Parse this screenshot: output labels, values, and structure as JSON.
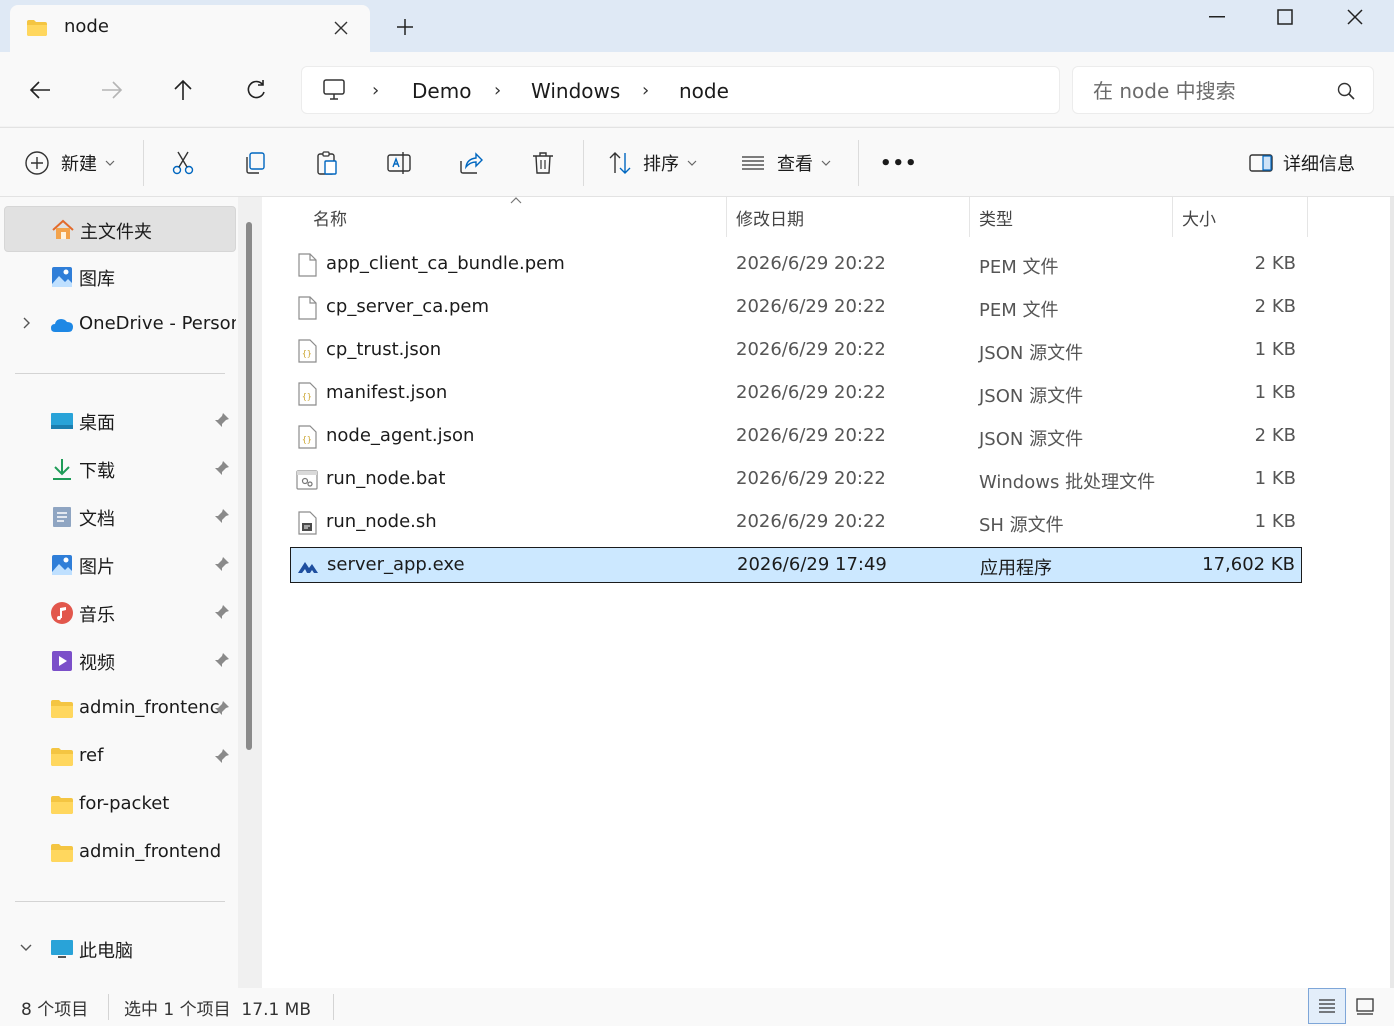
{
  "window": {
    "tab_title": "node",
    "colors": {
      "accent": "#0067c0",
      "selection": "#cce8ff",
      "folder": "#f4c542"
    }
  },
  "nav": {
    "breadcrumbs": [
      "Demo",
      "Windows",
      "node"
    ],
    "search_placeholder": "在 node 中搜索"
  },
  "toolbar": {
    "new_label": "新建",
    "sort_label": "排序",
    "view_label": "查看",
    "more_label": "•••",
    "details_label": "详细信息"
  },
  "sidebar": {
    "top": [
      {
        "label": "主文件夹",
        "icon": "home-icon"
      },
      {
        "label": "图库",
        "icon": "gallery-icon"
      },
      {
        "label": "OneDrive - Person",
        "icon": "onedrive-icon"
      }
    ],
    "quick": [
      {
        "label": "桌面",
        "icon": "desktop-icon"
      },
      {
        "label": "下载",
        "icon": "download-icon"
      },
      {
        "label": "文档",
        "icon": "documents-icon"
      },
      {
        "label": "图片",
        "icon": "pictures-icon"
      },
      {
        "label": "音乐",
        "icon": "music-icon"
      },
      {
        "label": "视频",
        "icon": "videos-icon"
      },
      {
        "label": "admin_frontenc",
        "icon": "folder-icon"
      },
      {
        "label": "ref",
        "icon": "folder-icon"
      },
      {
        "label": "for-packet",
        "icon": "folder-icon"
      },
      {
        "label": "admin_frontend",
        "icon": "folder-icon"
      }
    ],
    "this_pc": {
      "label": "此电脑",
      "icon": "pc-icon"
    }
  },
  "columns": {
    "name": "名称",
    "date": "修改日期",
    "type": "类型",
    "size": "大小"
  },
  "files": [
    {
      "name": "app_client_ca_bundle.pem",
      "date": "2026/6/29 20:22",
      "type": "PEM 文件",
      "size": "2 KB",
      "icon": "file-icon"
    },
    {
      "name": "cp_server_ca.pem",
      "date": "2026/6/29 20:22",
      "type": "PEM 文件",
      "size": "2 KB",
      "icon": "file-icon"
    },
    {
      "name": "cp_trust.json",
      "date": "2026/6/29 20:22",
      "type": "JSON 源文件",
      "size": "1 KB",
      "icon": "json-file-icon"
    },
    {
      "name": "manifest.json",
      "date": "2026/6/29 20:22",
      "type": "JSON 源文件",
      "size": "1 KB",
      "icon": "json-file-icon"
    },
    {
      "name": "node_agent.json",
      "date": "2026/6/29 20:22",
      "type": "JSON 源文件",
      "size": "2 KB",
      "icon": "json-file-icon"
    },
    {
      "name": "run_node.bat",
      "date": "2026/6/29 20:22",
      "type": "Windows 批处理文件",
      "size": "1 KB",
      "icon": "batch-file-icon"
    },
    {
      "name": "run_node.sh",
      "date": "2026/6/29 20:22",
      "type": "SH 源文件",
      "size": "1 KB",
      "icon": "script-file-icon"
    },
    {
      "name": "server_app.exe",
      "date": "2026/6/29 17:49",
      "type": "应用程序",
      "size": "17,602 KB",
      "icon": "app-icon"
    }
  ],
  "status": {
    "count": "8 个项目",
    "selection": "选中 1 个项目  17.1 MB"
  }
}
